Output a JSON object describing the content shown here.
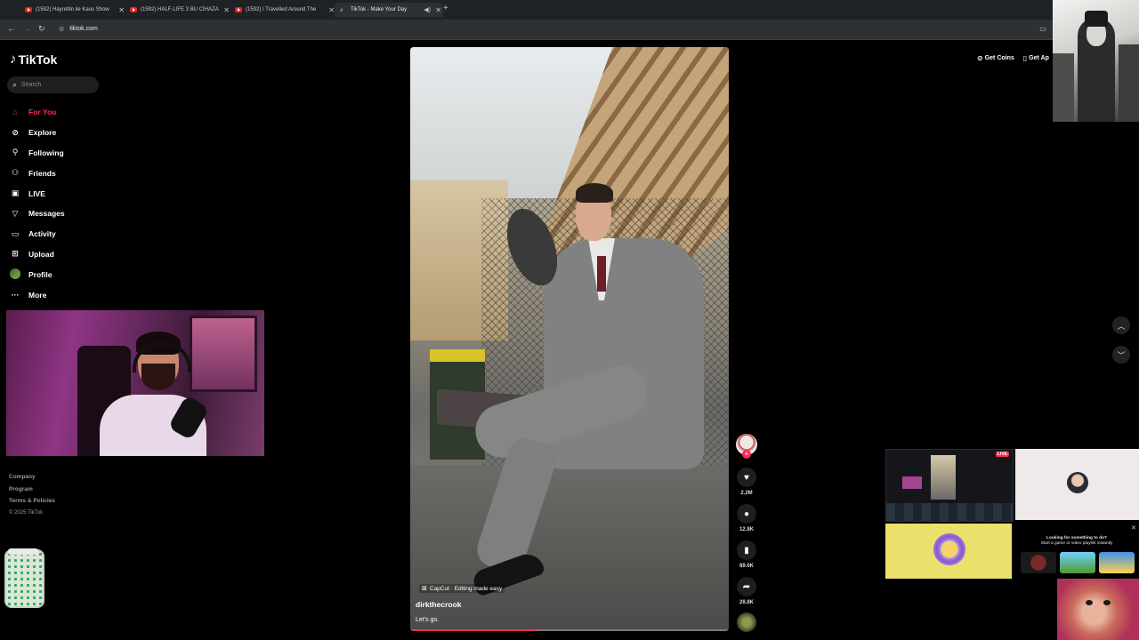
{
  "browser": {
    "tabs": [
      {
        "title": "(1592) Hayrettin ile Kaos Show",
        "icon": "youtube-icon"
      },
      {
        "title": "(1592) HALF-LIFE 3 BU CİHAZA",
        "icon": "youtube-icon"
      },
      {
        "title": "(1592) I Travelled Around The",
        "icon": "youtube-icon"
      },
      {
        "title": "TikTok - Make Your Day",
        "icon": "tiktok-icon",
        "active": true
      }
    ],
    "url": "tiktok.com"
  },
  "tiktok": {
    "logo_text": "TikTok",
    "accent_color": "#fe2c55",
    "search_placeholder": "Search",
    "nav": [
      {
        "label": "For You",
        "icon": "home-icon",
        "active": true
      },
      {
        "label": "Explore",
        "icon": "compass-icon"
      },
      {
        "label": "Following",
        "icon": "following-icon"
      },
      {
        "label": "Friends",
        "icon": "friends-icon"
      },
      {
        "label": "LIVE",
        "icon": "live-tv-icon"
      },
      {
        "label": "Messages",
        "icon": "send-icon"
      },
      {
        "label": "Activity",
        "icon": "activity-icon"
      },
      {
        "label": "Upload",
        "icon": "plus-square-icon"
      },
      {
        "label": "Profile",
        "icon": "profile-avatar"
      },
      {
        "label": "More",
        "icon": "more-dots-icon"
      }
    ],
    "footer": {
      "company": "Company",
      "program": "Program",
      "terms": "Terms & Policies",
      "copyright": "© 2025 TikTok"
    },
    "header_right": {
      "get_coins": "Get Coins",
      "get_app": "Get Ap"
    },
    "video": {
      "capcut": "CapCut · Editing made easy",
      "author": "dirkthecrook",
      "caption": "Let's go.",
      "progress": 0.39
    },
    "actions": {
      "likes": "2.2M",
      "comments": "12.8K",
      "saves": "89.6K",
      "shares": "28.8K"
    }
  },
  "overlays": {
    "live_badge": "LIVE",
    "playable_title": "Looking for something to do?",
    "playable_sub": "Start a game or video playlist instantly"
  }
}
